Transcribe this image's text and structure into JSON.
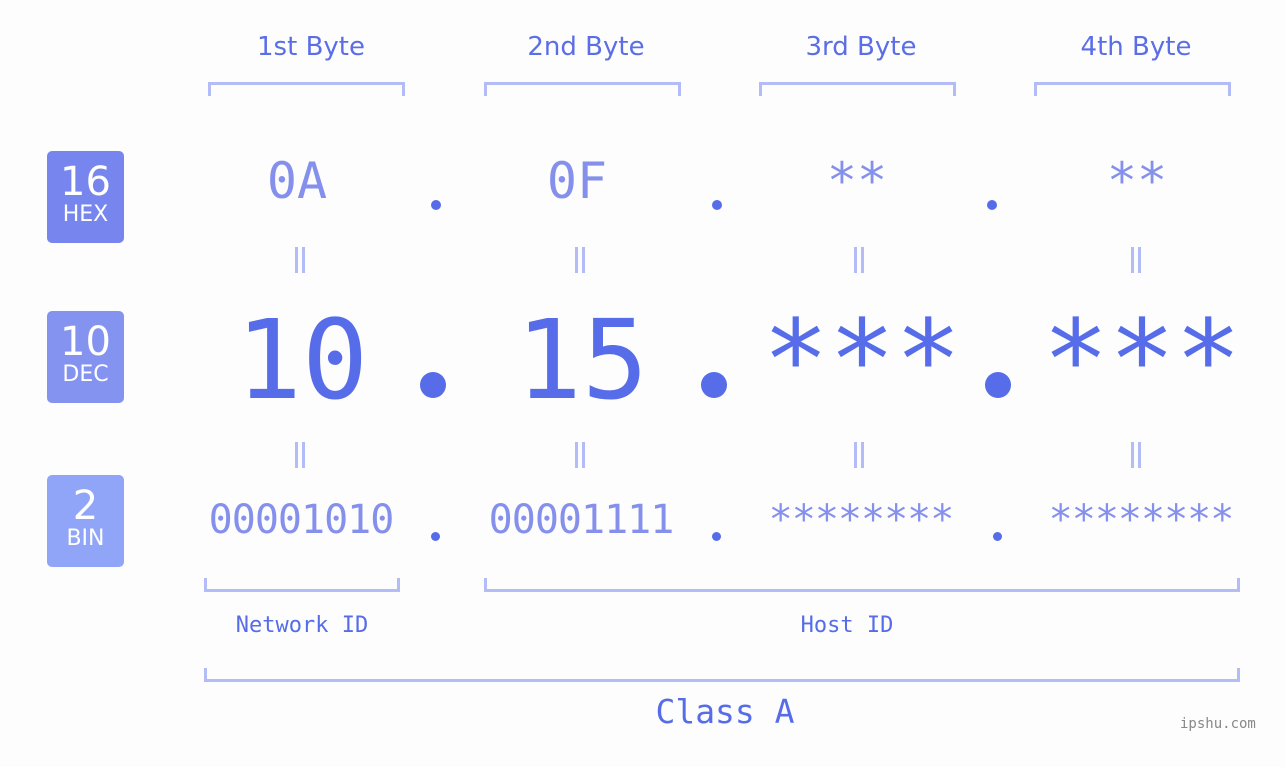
{
  "byte_headers": [
    "1st Byte",
    "2nd Byte",
    "3rd Byte",
    "4th Byte"
  ],
  "badges": {
    "hex": {
      "number": "16",
      "label": "HEX",
      "color": "#7785ee"
    },
    "dec": {
      "number": "10",
      "label": "DEC",
      "color": "#8593f0"
    },
    "bin": {
      "number": "2",
      "label": "BIN",
      "color": "#90a5f7"
    }
  },
  "hex_values": [
    "0A",
    "0F",
    "**",
    "**"
  ],
  "dec_values": [
    "10",
    "15",
    "***",
    "***"
  ],
  "bin_values": [
    "00001010",
    "00001111",
    "********",
    "********"
  ],
  "sections": {
    "network": "Network ID",
    "host": "Host ID",
    "class": "Class A"
  },
  "watermark": "ipshu.com",
  "colors": {
    "primary": "#566ce9",
    "light": "#8490ec",
    "bracket": "#b3bcf7"
  }
}
